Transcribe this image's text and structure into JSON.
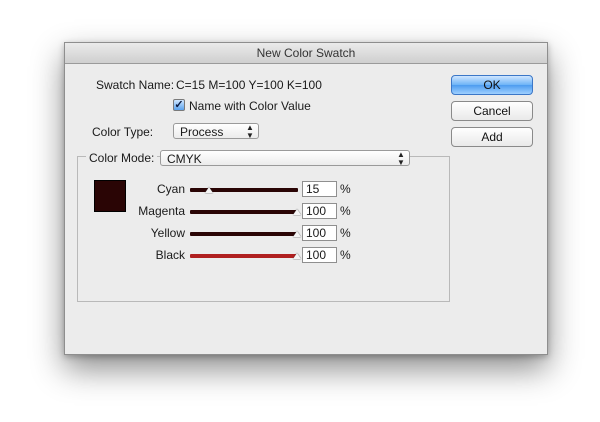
{
  "dialog": {
    "title": "New Color Swatch",
    "swatch_name_label": "Swatch Name:",
    "swatch_name_value": "C=15 M=100 Y=100 K=100",
    "name_with_value_label": "Name with Color Value",
    "name_with_value_checked": true,
    "color_type_label": "Color Type:",
    "color_type_value": "Process",
    "color_mode_label": "Color Mode:",
    "color_mode_value": "CMYK",
    "swatch_color": "#2a0505"
  },
  "channels": [
    {
      "label": "Cyan",
      "value": "15",
      "fraction": 0.15,
      "track_color": "#2a0505"
    },
    {
      "label": "Magenta",
      "value": "100",
      "fraction": 1.0,
      "track_color": "#2a0505"
    },
    {
      "label": "Yellow",
      "value": "100",
      "fraction": 1.0,
      "track_color": "#2a0505"
    },
    {
      "label": "Black",
      "value": "100",
      "fraction": 1.0,
      "track_color": "#b02020"
    }
  ],
  "percent_sign": "%",
  "buttons": {
    "ok": "OK",
    "cancel": "Cancel",
    "add": "Add"
  }
}
